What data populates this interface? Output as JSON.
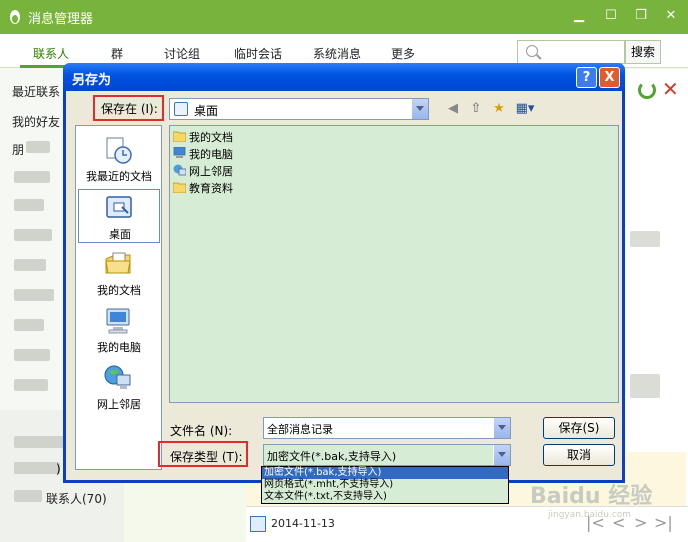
{
  "app": {
    "title": "消息管理器",
    "tabs": [
      "联系人",
      "群",
      "讨论组",
      "临时会话",
      "系统消息",
      "更多"
    ],
    "search_button": "搜索",
    "sidebar": {
      "recent": "最近联系",
      "friends": "我的好友",
      "friend_initial": "朋",
      "group_count": ")",
      "contacts": "联系人(70)"
    },
    "date": "2014-11-13"
  },
  "dialog": {
    "title": "另存为",
    "help_label": "?",
    "close_label": "X",
    "save_in_label": "保存在 (I):",
    "save_in_value": "桌面",
    "places": [
      {
        "label": "我最近的文档",
        "icon": "recent-docs-icon"
      },
      {
        "label": "桌面",
        "icon": "desktop-icon"
      },
      {
        "label": "我的文档",
        "icon": "my-documents-icon"
      },
      {
        "label": "我的电脑",
        "icon": "my-computer-icon"
      },
      {
        "label": "网上邻居",
        "icon": "network-places-icon"
      }
    ],
    "files": [
      {
        "label": "我的文档",
        "icon": "folder-icon"
      },
      {
        "label": "我的电脑",
        "icon": "computer-icon"
      },
      {
        "label": "网上邻居",
        "icon": "network-icon"
      },
      {
        "label": "教育资料",
        "icon": "folder-icon"
      }
    ],
    "filename_label": "文件名 (N):",
    "filename_value": "全部消息记录",
    "filetype_label": "保存类型 (T):",
    "filetype_value": "加密文件(*.bak,支持导入)",
    "filetype_options": [
      "加密文件(*.bak,支持导入)",
      "网页格式(*.mht,不支持导入)",
      "文本文件(*.txt,不支持导入)"
    ],
    "save_button": "保存(S)",
    "cancel_button": "取消"
  },
  "watermark": {
    "brand": "Baidu 经验",
    "url": "jingyan.baidu.com"
  },
  "colors": {
    "app_green": "#78b43c",
    "xp_blue": "#0054e3",
    "highlight": "#e02c2c",
    "list_bg": "#d7ecd5"
  }
}
